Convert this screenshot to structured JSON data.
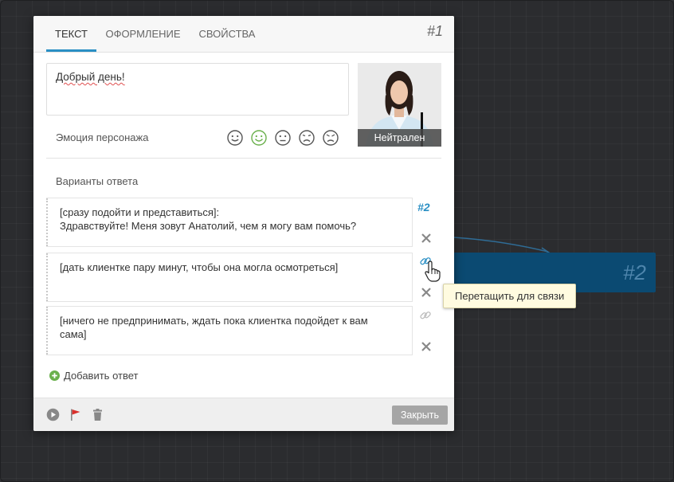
{
  "tabs": [
    {
      "label": "ТЕКСТ",
      "active": true
    },
    {
      "label": "ОФОРМЛЕНИЕ",
      "active": false
    },
    {
      "label": "СВОЙСТВА",
      "active": false
    }
  ],
  "dialog_id": "#1",
  "message": {
    "text": "Добрый день!"
  },
  "character": {
    "emotion_caption": "Нейтрален"
  },
  "emotion": {
    "label": "Эмоция персонажа",
    "icons": [
      "smile-icon",
      "happy-icon",
      "neutral-icon",
      "sad-icon",
      "angry-icon"
    ],
    "selected": 1
  },
  "answers": {
    "label": "Варианты ответа",
    "items": [
      {
        "line1": "[сразу подойти и представиться]:",
        "line2": "Здравствуйте! Меня зовут Анатолий, чем я могу вам помочь?",
        "target": "#2"
      },
      {
        "line1": "[дать клиентке пару минут, чтобы она могла осмотреться]",
        "line2": "",
        "target": ""
      },
      {
        "line1": "[ничего не предпринимать, ждать пока клиентка подойдет к вам",
        "line2": "сама]",
        "target": ""
      }
    ],
    "add_label": "Добавить ответ"
  },
  "tooltip": "Перетащить для связи",
  "footer": {
    "close_label": "Закрыть"
  },
  "node": {
    "id": "#2"
  },
  "colors": {
    "accent": "#2a8fc4",
    "node": "#0b4a72",
    "selected_emotion": "#6ab04c",
    "add_icon": "#6ab04c",
    "flag": "#d9302c"
  }
}
